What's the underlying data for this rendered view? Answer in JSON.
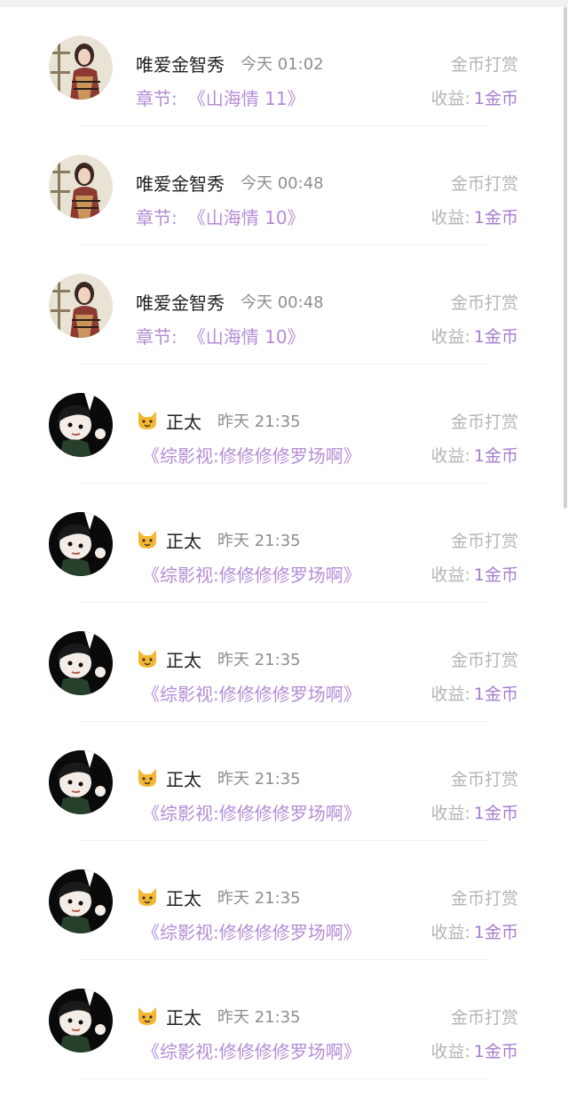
{
  "list": {
    "items": [
      {
        "name": "唯爱金智秀",
        "time": "今天 01:02",
        "prefix": "章节:",
        "title": "《山海情 11》",
        "type": "金币打赏",
        "income_label": "收益:",
        "income_value": "1金币",
        "avatar_icon": "woman-photo-avatar",
        "emoji_icon": ""
      },
      {
        "name": "唯爱金智秀",
        "time": "今天 00:48",
        "prefix": "章节:",
        "title": "《山海情 10》",
        "type": "金币打赏",
        "income_label": "收益:",
        "income_value": "1金币",
        "avatar_icon": "woman-photo-avatar",
        "emoji_icon": ""
      },
      {
        "name": "唯爱金智秀",
        "time": "今天 00:48",
        "prefix": "章节:",
        "title": "《山海情 10》",
        "type": "金币打赏",
        "income_label": "收益:",
        "income_value": "1金币",
        "avatar_icon": "woman-photo-avatar",
        "emoji_icon": ""
      },
      {
        "name": "正太",
        "time": "昨天 21:35",
        "prefix": "",
        "title": "《综影视:修修修修罗场啊》",
        "type": "金币打赏",
        "income_label": "收益:",
        "income_value": "1金币",
        "avatar_icon": "cartoon-boy-avatar",
        "emoji_icon": "cat-face-icon"
      },
      {
        "name": "正太",
        "time": "昨天 21:35",
        "prefix": "",
        "title": "《综影视:修修修修罗场啊》",
        "type": "金币打赏",
        "income_label": "收益:",
        "income_value": "1金币",
        "avatar_icon": "cartoon-boy-avatar",
        "emoji_icon": "cat-face-icon"
      },
      {
        "name": "正太",
        "time": "昨天 21:35",
        "prefix": "",
        "title": "《综影视:修修修修罗场啊》",
        "type": "金币打赏",
        "income_label": "收益:",
        "income_value": "1金币",
        "avatar_icon": "cartoon-boy-avatar",
        "emoji_icon": "cat-face-icon"
      },
      {
        "name": "正太",
        "time": "昨天 21:35",
        "prefix": "",
        "title": "《综影视:修修修修罗场啊》",
        "type": "金币打赏",
        "income_label": "收益:",
        "income_value": "1金币",
        "avatar_icon": "cartoon-boy-avatar",
        "emoji_icon": "cat-face-icon"
      },
      {
        "name": "正太",
        "time": "昨天 21:35",
        "prefix": "",
        "title": "《综影视:修修修修罗场啊》",
        "type": "金币打赏",
        "income_label": "收益:",
        "income_value": "1金币",
        "avatar_icon": "cartoon-boy-avatar",
        "emoji_icon": "cat-face-icon"
      },
      {
        "name": "正太",
        "time": "昨天 21:35",
        "prefix": "",
        "title": "《综影视:修修修修罗场啊》",
        "type": "金币打赏",
        "income_label": "收益:",
        "income_value": "1金币",
        "avatar_icon": "cartoon-boy-avatar",
        "emoji_icon": "cat-face-icon"
      }
    ]
  },
  "colors": {
    "accent_purple": "#b48dd6",
    "income_purple": "#a67fd0",
    "muted_gray": "#b5b5b5",
    "name_text": "#222222"
  }
}
